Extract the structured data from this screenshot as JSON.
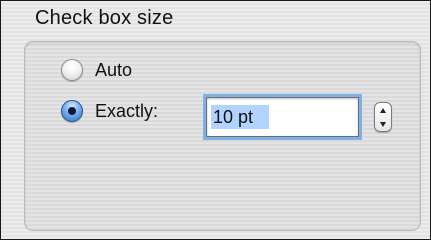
{
  "group": {
    "title": "Check box size"
  },
  "options": [
    {
      "label": "Auto",
      "selected": false
    },
    {
      "label": "Exactly:",
      "selected": true
    }
  ],
  "size_field": {
    "value": "10 pt",
    "selected_text": "10 pt"
  },
  "stepper": {
    "up_icon": "chevron-up-icon",
    "down_icon": "chevron-down-icon"
  },
  "colors": {
    "focus_ring": "#7fb0ea",
    "selection": "#b3d3ff",
    "radio_on": "#2f6fd0"
  }
}
